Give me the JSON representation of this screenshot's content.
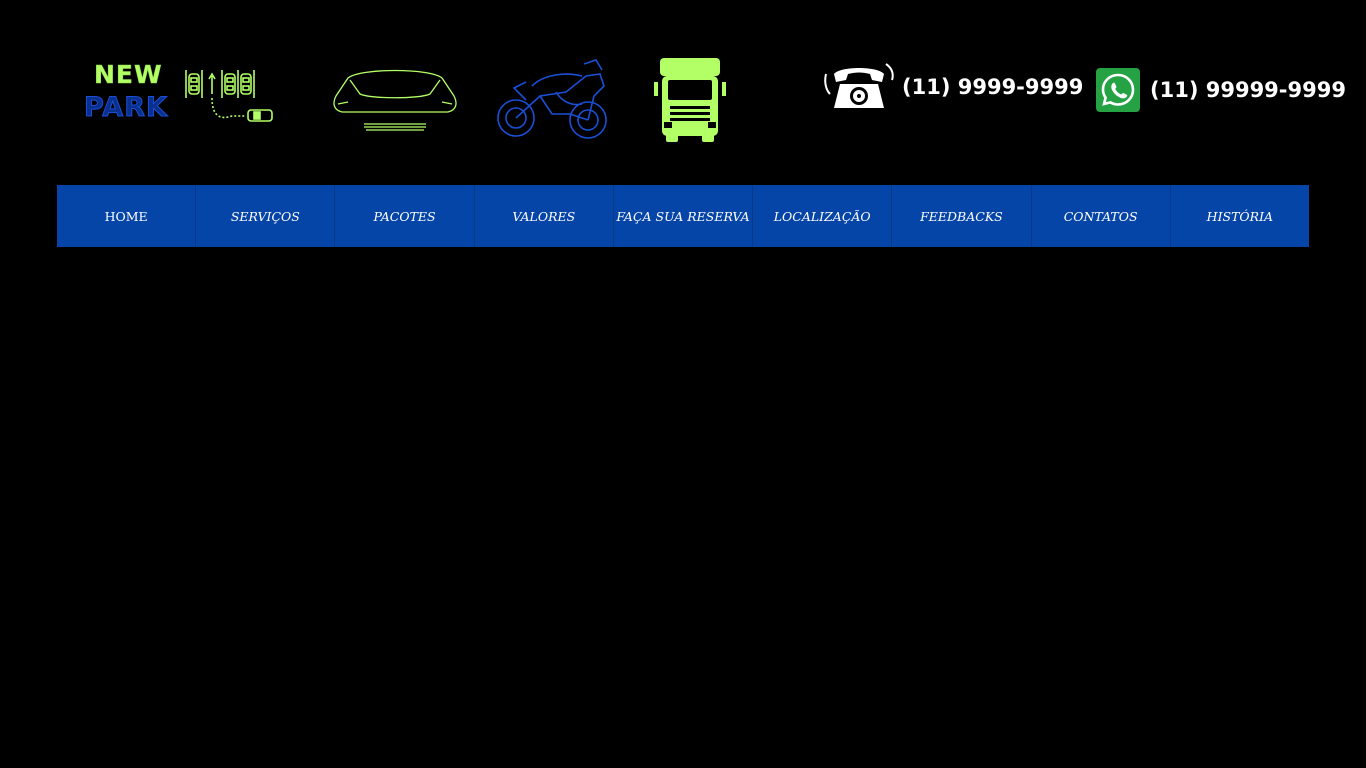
{
  "brand": {
    "line1": "NEW",
    "line2": "PARK"
  },
  "vehicles": [
    {
      "name": "car-icon"
    },
    {
      "name": "motorcycle-icon"
    },
    {
      "name": "truck-icon"
    }
  ],
  "contacts": {
    "phone": {
      "icon": "telephone-icon",
      "number": "(11) 9999-9999"
    },
    "whatsapp": {
      "icon": "whatsapp-icon",
      "number": "(11) 99999-9999"
    }
  },
  "nav": {
    "items": [
      {
        "label": "HOME"
      },
      {
        "label": "SERVIÇOS"
      },
      {
        "label": "PACOTES"
      },
      {
        "label": "VALORES"
      },
      {
        "label": "FAÇA SUA RESERVA"
      },
      {
        "label": "LOCALIZAÇÃO"
      },
      {
        "label": "FEEDBACKS"
      },
      {
        "label": "CONTATOS"
      },
      {
        "label": "HISTÓRIA"
      }
    ]
  },
  "colors": {
    "background": "#000000",
    "nav_background": "#0645a8",
    "lime": "#b3ff66",
    "brand_blue": "#1a4fd6",
    "whatsapp_green": "#25a244",
    "text": "#ffffff"
  }
}
